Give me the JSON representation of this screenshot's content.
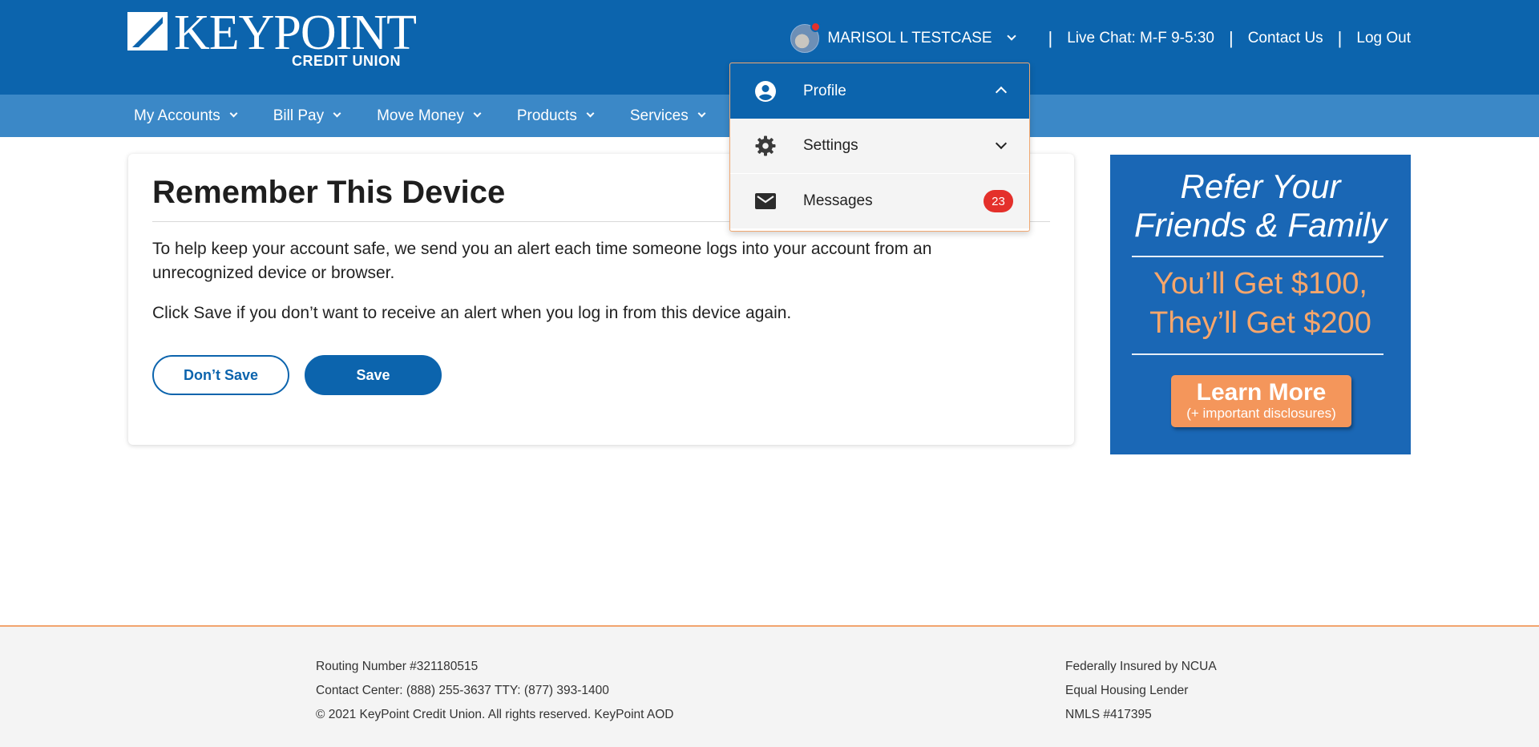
{
  "brand": {
    "name": "KEYPOINT",
    "subname": "CREDIT UNION"
  },
  "header": {
    "user_name": "MARISOL L TESTCASE",
    "live_chat": "Live Chat: M-F 9-5:30",
    "contact_us": "Contact Us",
    "log_out": "Log Out",
    "separator": "|"
  },
  "nav": {
    "items": [
      {
        "label": "My Accounts"
      },
      {
        "label": "Bill Pay"
      },
      {
        "label": "Move Money"
      },
      {
        "label": "Products"
      },
      {
        "label": "Services"
      }
    ]
  },
  "dropdown": {
    "items": [
      {
        "label": "Profile",
        "icon": "user-circle-icon",
        "state": "expanded"
      },
      {
        "label": "Settings",
        "icon": "gear-icon",
        "state": "collapsed"
      },
      {
        "label": "Messages",
        "icon": "envelope-icon",
        "badge": "23"
      }
    ]
  },
  "card": {
    "title": "Remember This Device",
    "paragraph1": "To help keep your account safe, we send you an alert each time someone logs into your account from an unrecognized device or browser.",
    "paragraph2": "Click Save if you don’t want to receive an alert when you log in from this device again.",
    "dont_save_label": "Don’t Save",
    "save_label": "Save"
  },
  "ad": {
    "line1": "Refer Your",
    "line2": "Friends & Family",
    "offer1": "You’ll Get $100,",
    "offer2": "They’ll Get $200",
    "cta_main": "Learn More",
    "cta_sub": "(+ important disclosures)"
  },
  "footer": {
    "left": [
      "Routing Number #321180515",
      "Contact Center: (888) 255-3637 TTY: (877) 393-1400",
      "© 2021 KeyPoint Credit Union. All rights reserved. KeyPoint AOD"
    ],
    "right": [
      "Federally Insured by NCUA",
      "Equal Housing Lender",
      "NMLS #417395"
    ]
  },
  "colors": {
    "header_blue": "#0c64ad",
    "nav_blue": "#3b88c7",
    "accent_orange": "#f4965b",
    "badge_red": "#e4302b"
  }
}
